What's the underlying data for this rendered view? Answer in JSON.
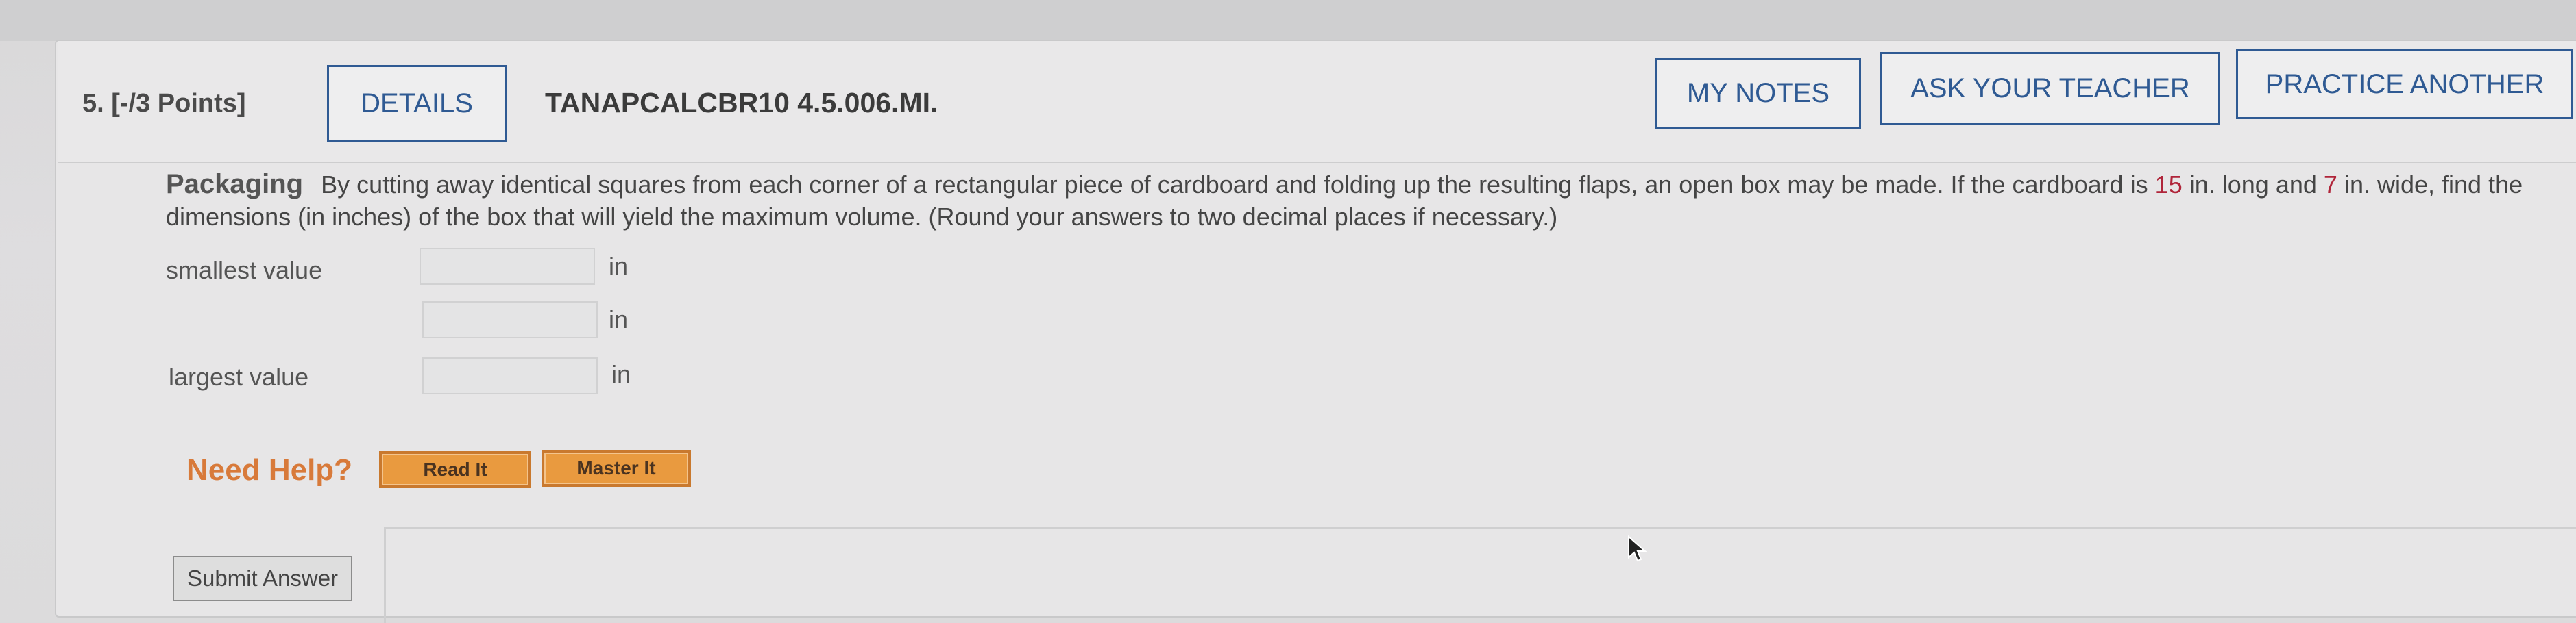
{
  "question": {
    "number_label": "5. [-/3 Points]",
    "details_label": "DETAILS",
    "code": "TANAPCALCBR10 4.5.006.MI."
  },
  "header_buttons": {
    "my_notes": "MY NOTES",
    "ask_teacher": "ASK YOUR TEACHER",
    "practice_another": "PRACTICE ANOTHER"
  },
  "problem": {
    "title": "Packaging",
    "text_before_length": "By cutting away identical squares from each corner of a rectangular piece of cardboard and folding up the resulting flaps, an open box may be made. If the cardboard is",
    "length": "15",
    "text_between": "in. long and",
    "width": "7",
    "text_after_width": "in. wide, find the dimensions (in inches) of the box that will yield the maximum volume. (Round your answers to two decimal places if necessary.)"
  },
  "answers": {
    "smallest_label": "smallest value",
    "largest_label": "largest value",
    "unit": "in",
    "values": [
      "",
      "",
      ""
    ]
  },
  "help": {
    "need_help": "Need Help?",
    "read_it": "Read It",
    "master_it": "Master It"
  },
  "submit_label": "Submit Answer",
  "colors": {
    "accent_blue": "#2f5a93",
    "value_red": "#b0253a",
    "help_orange": "#e99a3f"
  }
}
